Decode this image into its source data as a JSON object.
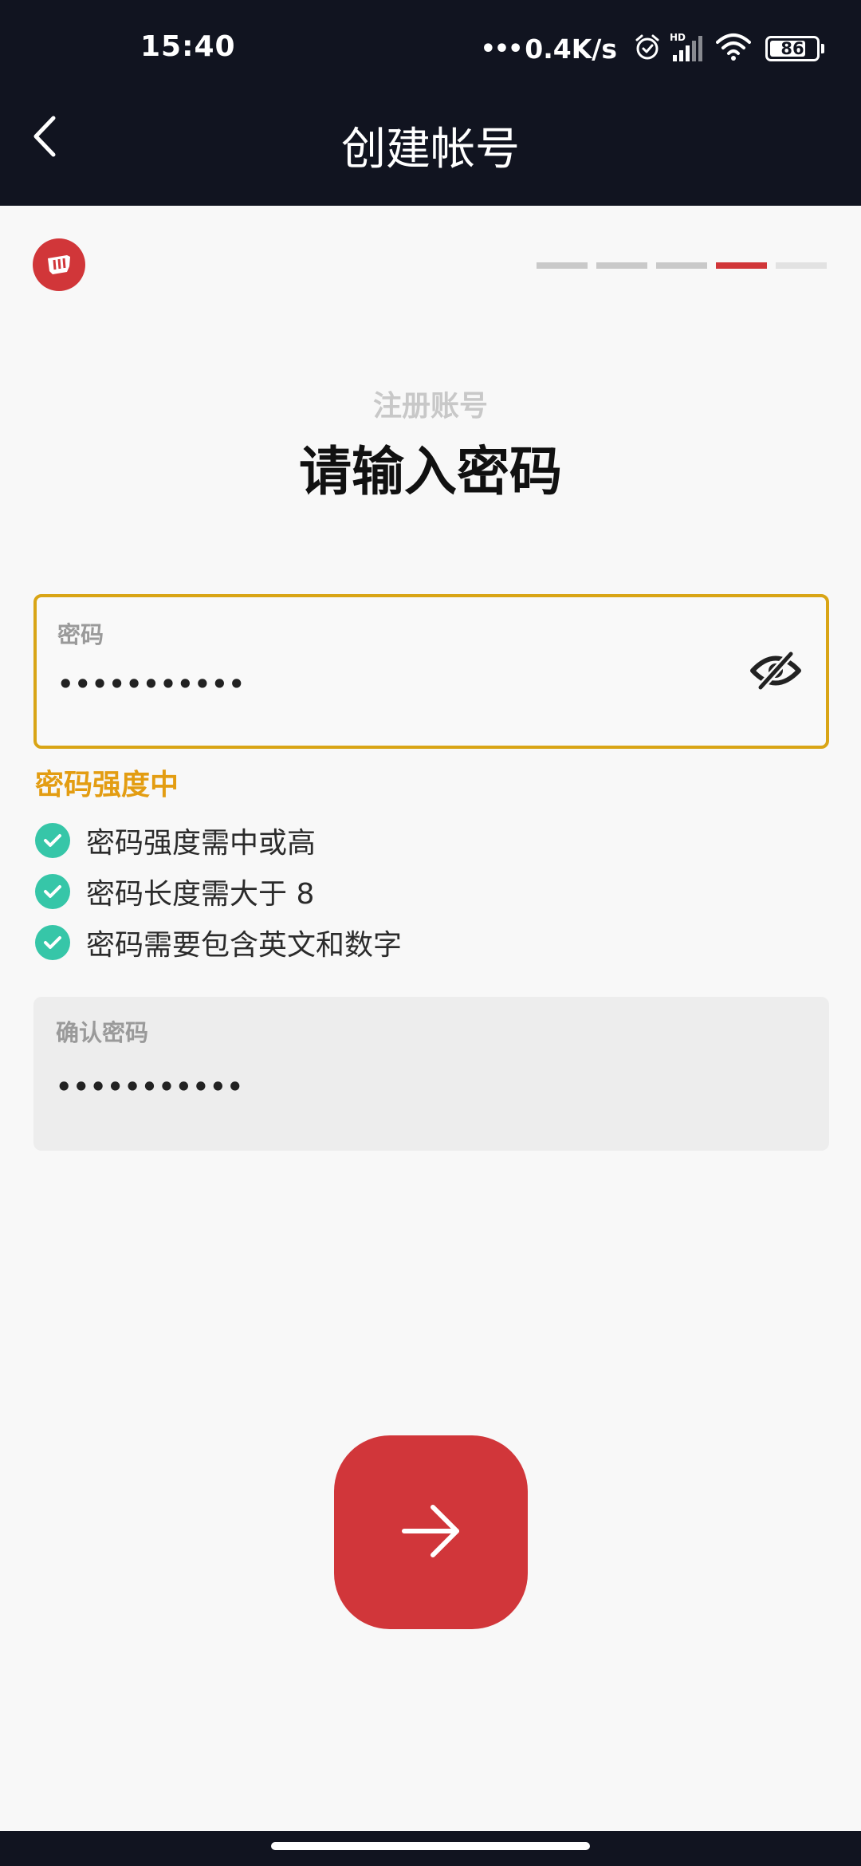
{
  "status_bar": {
    "time": "15:40",
    "network_speed": "0.4K/s",
    "network_dots": "•••",
    "battery_level": "86",
    "icons": [
      "alarm-icon",
      "hd-signal-icon",
      "wifi-icon",
      "battery-icon"
    ]
  },
  "header": {
    "title": "创建帐号",
    "back_icon": "chevron-left-icon"
  },
  "progress": {
    "total_steps": 5,
    "current_step": 4
  },
  "form": {
    "subtitle": "注册账号",
    "title": "请输入密码",
    "password": {
      "label": "密码",
      "value": "•••••••••••",
      "toggle_icon": "eye-slash-icon"
    },
    "strength_text": "密码强度中",
    "requirements": [
      {
        "text": "密码强度需中或高",
        "met": true
      },
      {
        "text": "密码长度需大于 8",
        "met": true
      },
      {
        "text": "密码需要包含英文和数字",
        "met": true
      }
    ],
    "confirm_password": {
      "label": "确认密码",
      "value": "•••••••••••"
    }
  },
  "next_button": {
    "icon": "arrow-right-icon"
  },
  "colors": {
    "brand_red": "#d13639",
    "focus_border": "#d9a516",
    "strength_text": "#e39d12",
    "check_green": "#36c6a8",
    "top_bar": "#111420"
  }
}
